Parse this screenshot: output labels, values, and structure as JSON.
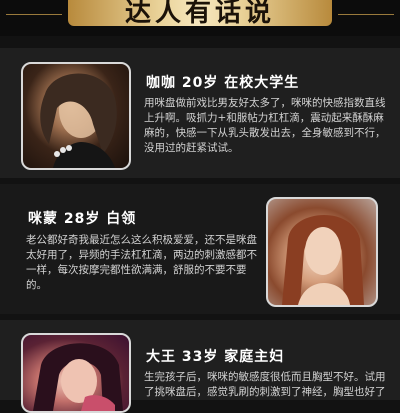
{
  "header": {
    "title": "达人有话说"
  },
  "testimonials": [
    {
      "name_line": "咖咖 20岁 在校大学生",
      "text": "用咪盘做前戏比男友好太多了，咪咪的快感指数直线上升啊。吸抓力+和服帖力杠杠滴，震动起来酥酥麻麻的，快感一下从乳头散发出去，全身敏感到不行，没用过的赶紧试试。",
      "photo_alt": "woman-portrait-1"
    },
    {
      "name_line": "咪蒙 28岁 白领",
      "text": "老公都好奇我最近怎么这么积极爱爱，还不是咪盘太好用了，异频的手法杠杠滴，两边的刺激感都不一样，每次按摩完都性欲满满，舒服的不要不要的。",
      "photo_alt": "woman-portrait-2"
    },
    {
      "name_line": "大王 33岁 家庭主妇",
      "text": "生完孩子后，咪咪的敏感度很低而且胸型不好。试用了挑咪盘后，感觉乳刷的刺激到了神经，胸型也好了",
      "photo_alt": "woman-portrait-3"
    }
  ],
  "colors": {
    "background": "#121212",
    "card": "#1f1f1f",
    "gold": "#ead39a",
    "name_text": "#ffffff",
    "body_text": "#d2d2d2"
  }
}
